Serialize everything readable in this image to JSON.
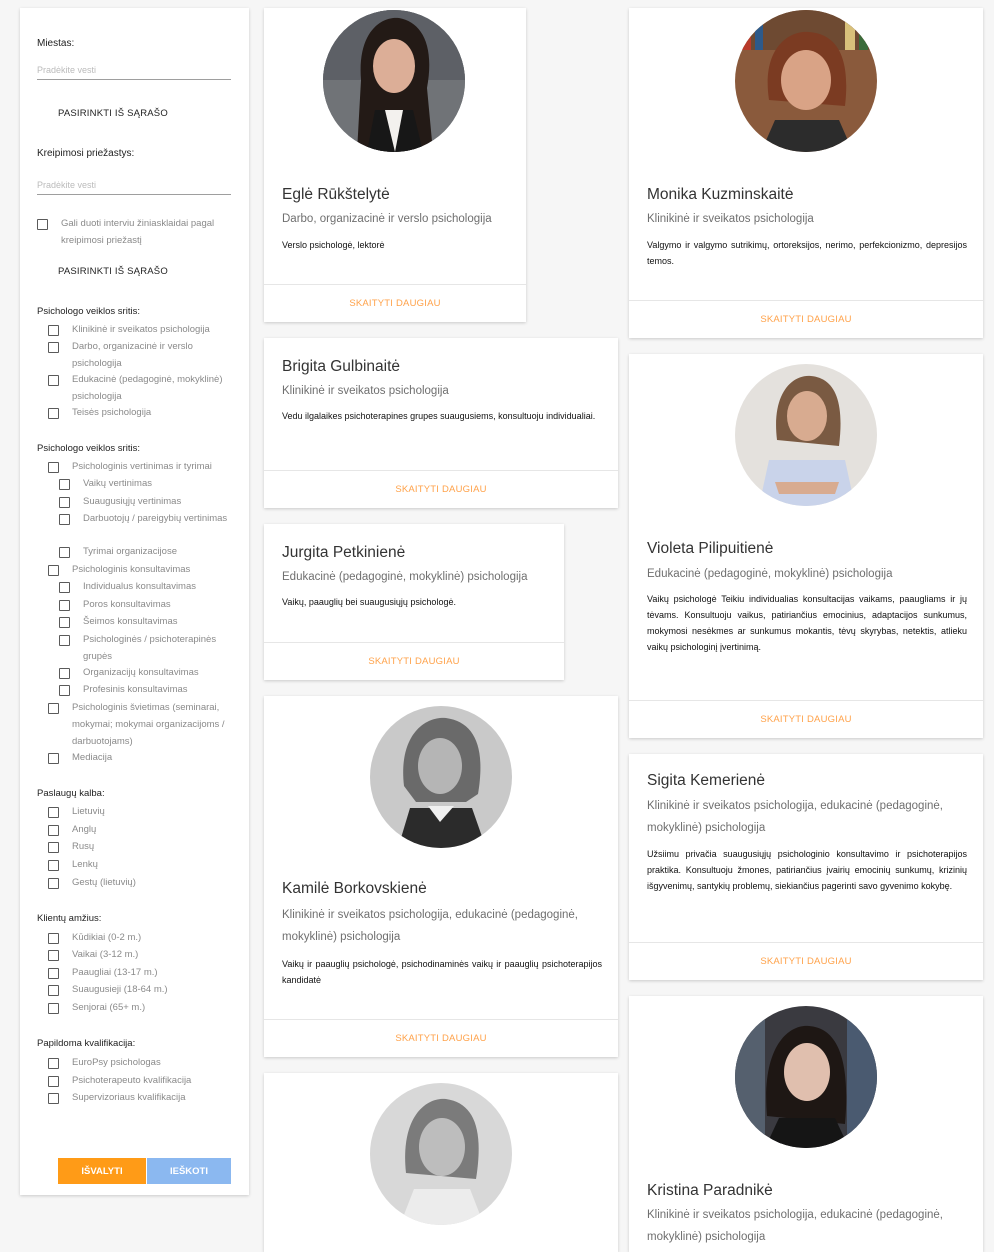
{
  "sidebar": {
    "city_label": "Miestas:",
    "city_placeholder": "Pradėkite vesti",
    "choose_from_list": "PASIRINKTI IŠ SĄRAŠO",
    "reason_label": "Kreipimosi priežastys:",
    "reason_placeholder": "Pradėkite vesti",
    "interview_checkbox": "Gali duoti interviu žiniasklaidai pagal kreipimosi priežastį",
    "activity_title_1": "Psichologo veiklos sritis:",
    "activity_items_1": [
      "Klinikinė ir sveikatos psichologija",
      "Darbo, organizacinė ir verslo psichologija",
      "Edukacinė (pedagoginė, mokyklinė) psichologija",
      "Teisės psichologija"
    ],
    "activity_title_2": "Psichologo veiklos sritis:",
    "assessment": "Psichologinis vertinimas ir tyrimai",
    "assessment_items": [
      "Vaikų vertinimas",
      "Suaugusiųjų vertinimas",
      "Darbuotojų / pareigybių vertinimas",
      "Tyrimai organizacijose"
    ],
    "consulting": "Psichologinis konsultavimas",
    "consulting_items": [
      "Individualus konsultavimas",
      "Poros konsultavimas",
      "Šeimos konsultavimas",
      "Psichologinės / psichoterapinės grupės",
      "Organizacijų konsultavimas",
      "Profesinis konsultavimas"
    ],
    "education": "Psichologinis švietimas (seminarai, mokymai; mokymai organizacijoms / darbuotojams)",
    "mediation": "Mediacija",
    "language_title": "Paslaugų kalba:",
    "languages": [
      "Lietuvių",
      "Anglų",
      "Rusų",
      "Lenkų",
      "Gestų (lietuvių)"
    ],
    "age_title": "Klientų amžius:",
    "ages": [
      "Kūdikiai (0-2 m.)",
      "Vaikai (3-12 m.)",
      "Paaugliai (13-17 m.)",
      "Suaugusieji (18-64 m.)",
      "Senjorai (65+ m.)"
    ],
    "qual_title": "Papildoma kvalifikacija:",
    "quals": [
      "EuroPsy psichologas",
      "Psichoterapeuto kvalifikacija",
      "Supervizoriaus kvalifikacija"
    ],
    "clear_button": "IŠVALYTI",
    "search_button": "IEŠKOTI"
  },
  "more_label": "SKAITYTI DAUGIAU",
  "cards": [
    {
      "name": "Eglė Rūkštelytė",
      "specialty": "Darbo, organizacinė ir verslo psichologija",
      "description": "Verslo psichologė, lektorė"
    },
    {
      "name": "Brigita Gulbinaitė",
      "specialty": "Klinikinė ir sveikatos psichologija",
      "description": "Vedu ilgalaikes psichoterapines grupes suaugusiems, konsultuoju individualiai."
    },
    {
      "name": "Jurgita Petkinienė",
      "specialty": "Edukacinė (pedagoginė, mokyklinė) psichologija",
      "description": "Vaikų, paauglių bei suaugusiųjų psichologė."
    },
    {
      "name": "Kamilė Borkovskienė",
      "specialty": "Klinikinė ir sveikatos psichologija, edukacinė (pedagoginė, mokyklinė) psichologija",
      "description": "Vaikų ir paauglių psichologė, psichodinaminės vaikų ir paauglių psichoterapijos kandidatė"
    },
    {
      "name": "Monika Kuzminskaitė",
      "specialty": "Klinikinė ir sveikatos psichologija",
      "description": "Valgymo ir valgymo sutrikimų, ortoreksijos, nerimo, perfekcionizmo, depresijos temos."
    },
    {
      "name": "Violeta Pilipuitienė",
      "specialty": "Edukacinė (pedagoginė, mokyklinė) psichologija",
      "description": "Vaikų psichologė Teikiu individualias konsultacijas vaikams, paaugliams ir jų tėvams. Konsultuoju vaikus, patiriančius emocinius, adaptacijos sunkumus, mokymosi nesėkmes ar sunkumus mokantis, tėvų skyrybas, netektis, atlieku vaikų psichologinį įvertinimą."
    },
    {
      "name": "Sigita Kemerienė",
      "specialty": "Klinikinė ir sveikatos psichologija, edukacinė (pedagoginė, mokyklinė) psichologija",
      "description": "Užsiimu privačia suaugusiųjų psichologinio konsultavimo ir psichoterapijos praktika. Konsultuoju žmones, patiriančius įvairių emocinių sunkumų, krizinių išgyvenimų, santykių problemų, siekiančius pagerinti savo gyvenimo kokybę."
    },
    {
      "name": "Kristina Paradnikė",
      "specialty": "Klinikinė ir sveikatos psichologija, edukacinė (pedagoginė, mokyklinė) psichologija",
      "description": ""
    }
  ]
}
